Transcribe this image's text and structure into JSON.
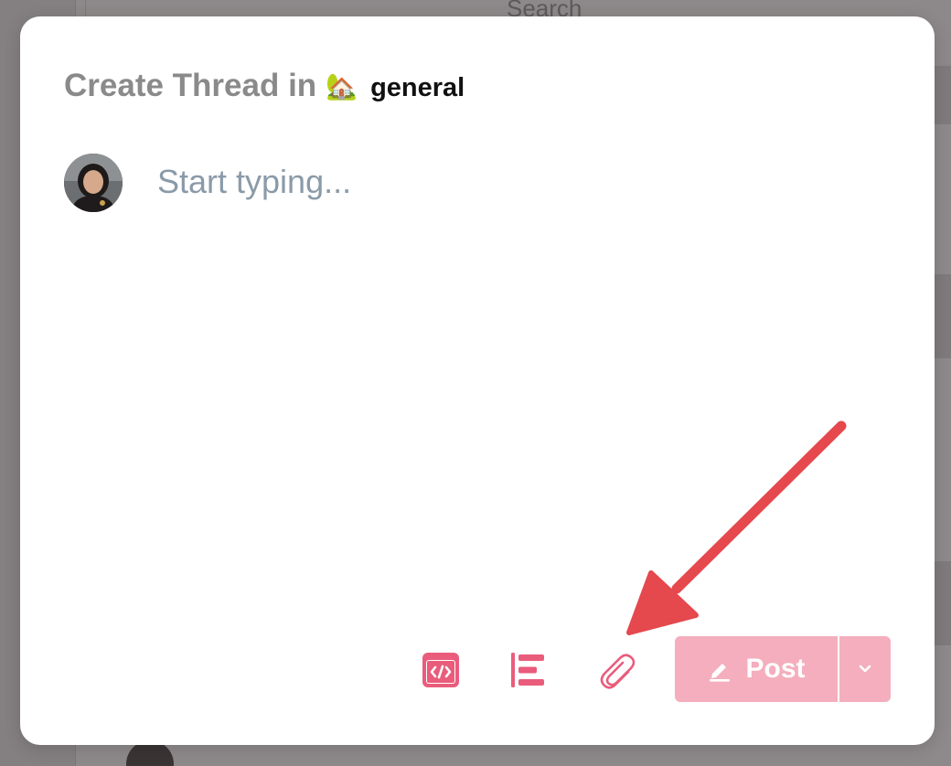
{
  "background": {
    "search_label": "Search"
  },
  "modal": {
    "title_prefix": "Create Thread in",
    "community_emoji": "🏡",
    "community_name": "general",
    "editor_placeholder": "Start typing...",
    "toolbar": {
      "embed_icon": "code-embed-icon",
      "format_icon": "text-format-icon",
      "attach_icon": "paperclip-icon",
      "post_label": "Post",
      "post_icon": "pencil-icon",
      "dropdown_icon": "chevron-down-icon"
    }
  },
  "colors": {
    "accent": "#e95c7b",
    "post_button_disabled": "#f4aebd",
    "arrow": "#e5484d",
    "placeholder": "#8a9aa8",
    "title_muted": "#8a8a8a"
  }
}
